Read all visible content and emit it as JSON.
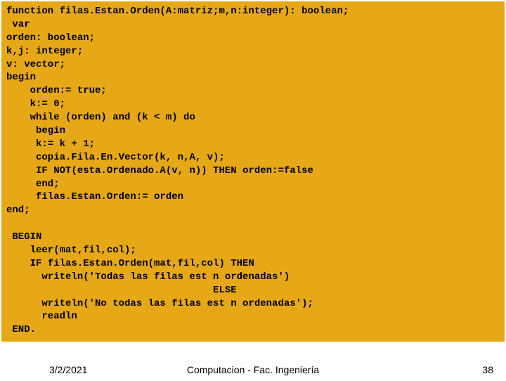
{
  "code": {
    "lines": [
      "function filas.Estan.Orden(A:matriz;m,n:integer): boolean;",
      " var",
      "orden: boolean;",
      "k,j: integer;",
      "v: vector;",
      "begin",
      "    orden:= true;",
      "    k:= 0;",
      "    while (orden) and (k < m) do",
      "     begin",
      "     k:= k + 1;",
      "     copia.Fila.En.Vector(k, n,A, v);",
      "     IF NOT(esta.Ordenado.A(v, n)) THEN orden:=false",
      "     end;",
      "     filas.Estan.Orden:= orden",
      "end;",
      "",
      " BEGIN",
      "    leer(mat,fil,col);",
      "    IF filas.Estan.Orden(mat,fil,col) THEN",
      "      writeln('Todas las filas est n ordenadas')",
      "                                   ELSE",
      "      writeln('No todas las filas est n ordenadas');",
      "      readln",
      " END."
    ]
  },
  "footer": {
    "date": "3/2/2021",
    "center": "Computacion  - Fac. Ingeniería",
    "page": "38"
  }
}
